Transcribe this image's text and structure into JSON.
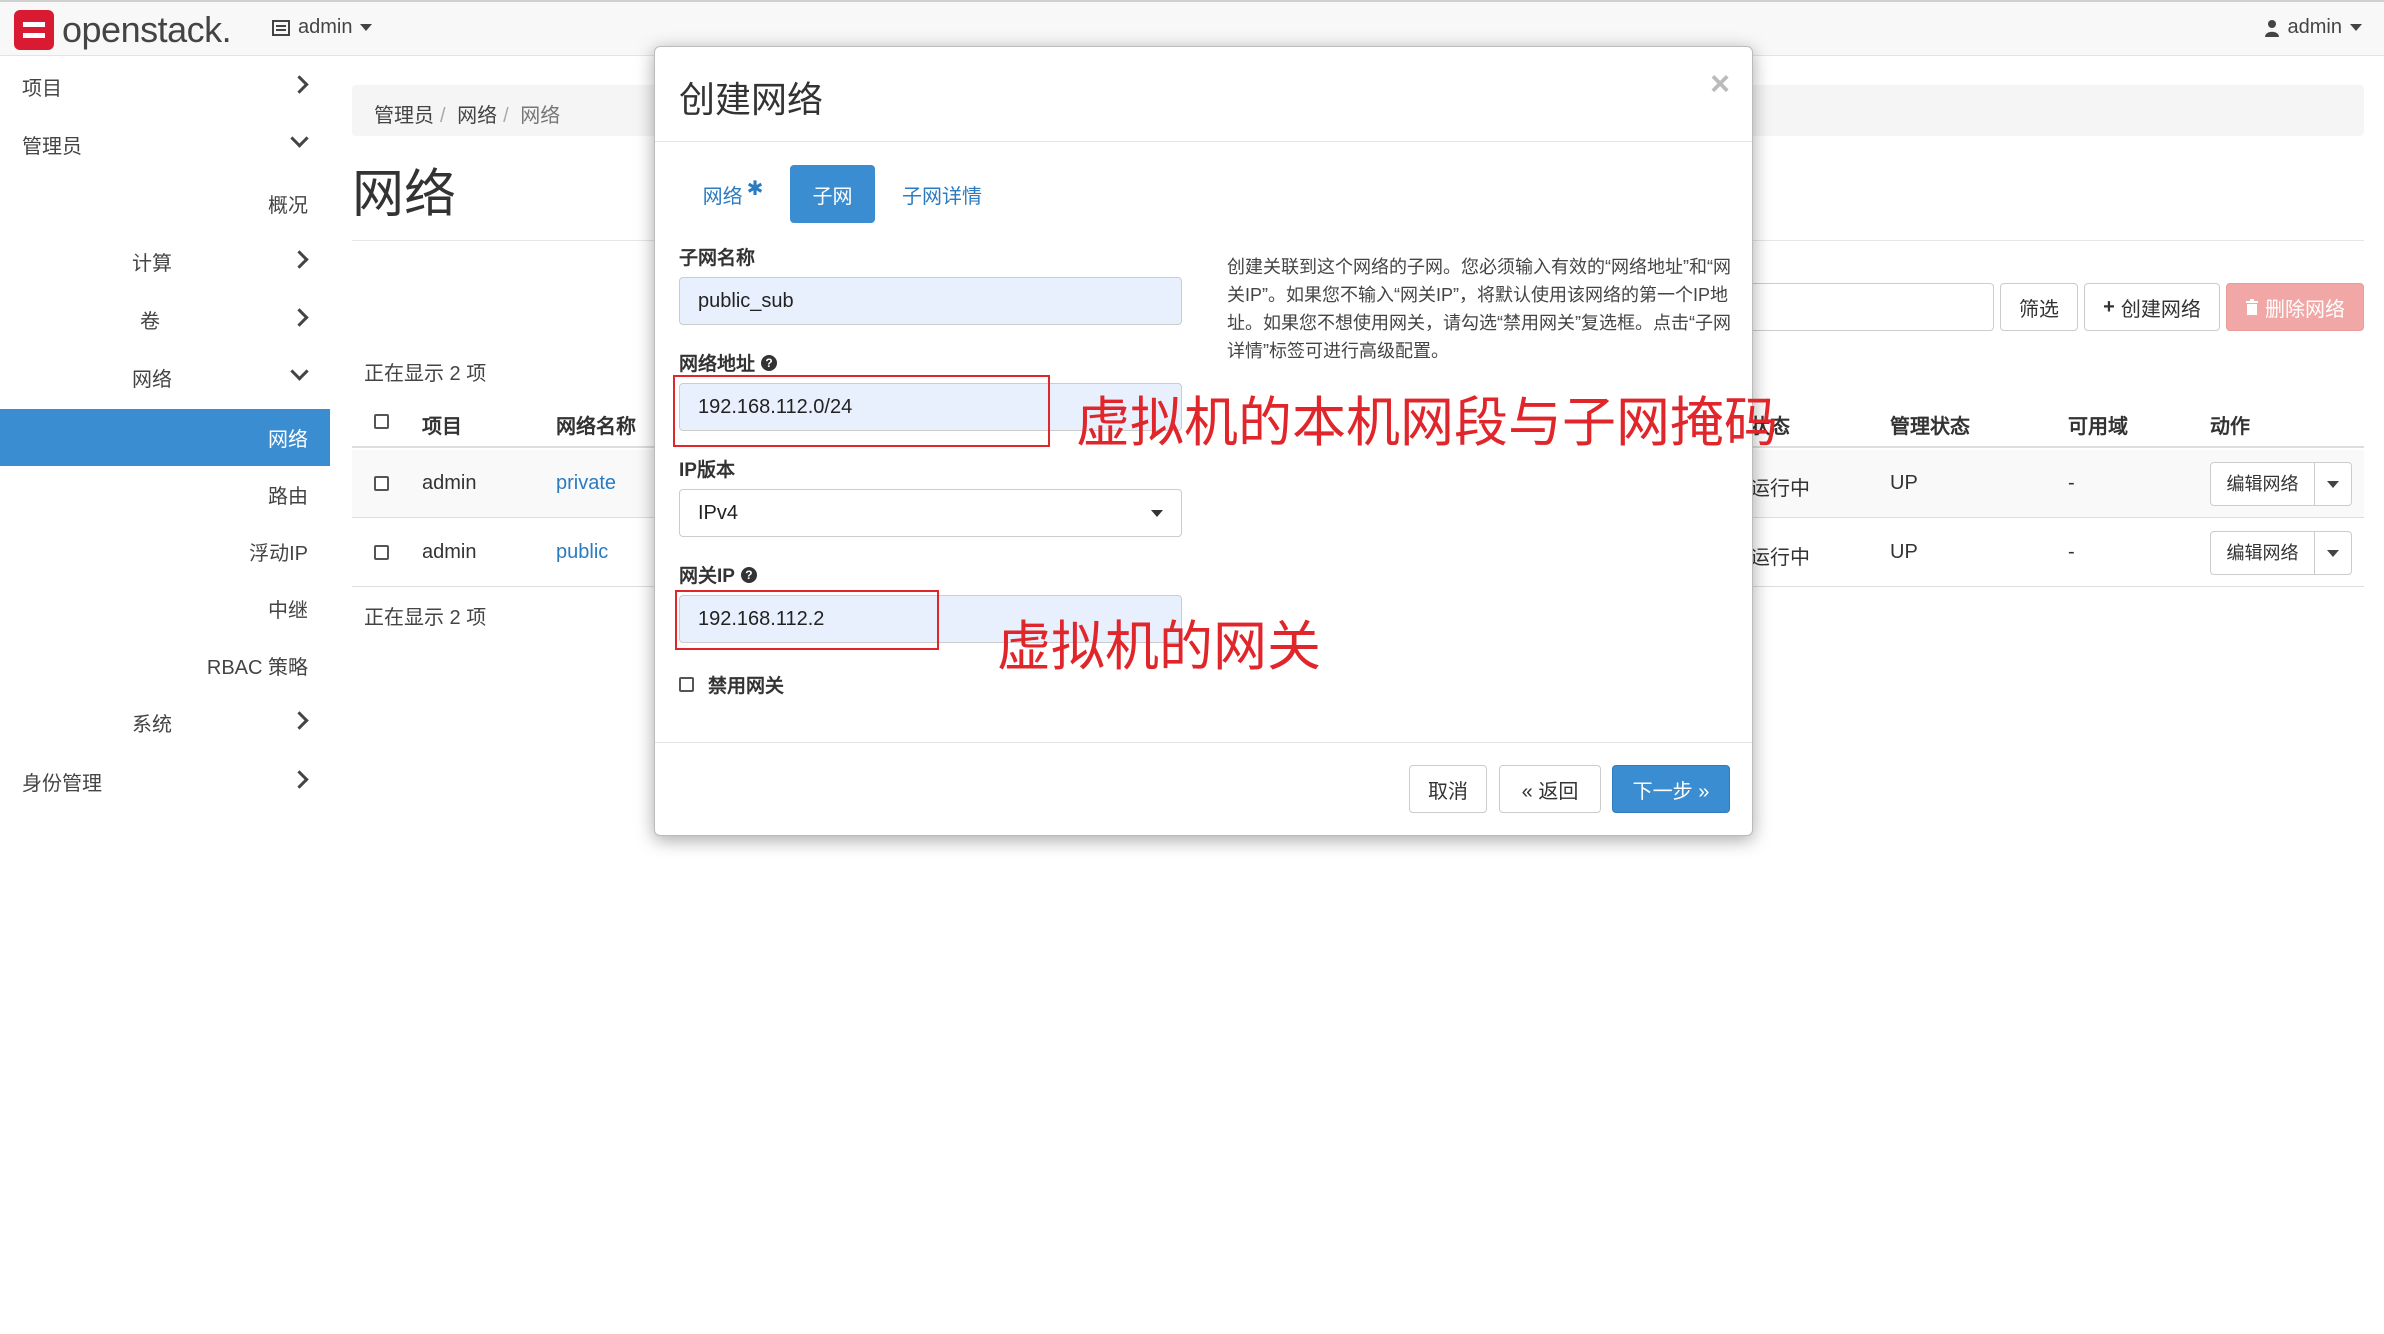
{
  "navbar": {
    "logo_text": "openstack.",
    "project": "admin",
    "user": "admin"
  },
  "sidebar": {
    "items": [
      {
        "label": "项目"
      },
      {
        "label": "管理员"
      },
      {
        "label": "概况"
      },
      {
        "label": "计算"
      },
      {
        "label": "卷"
      },
      {
        "label": "网络"
      },
      {
        "label": "网络"
      },
      {
        "label": "路由"
      },
      {
        "label": "浮动IP"
      },
      {
        "label": "中继"
      },
      {
        "label": "RBAC 策略"
      },
      {
        "label": "系统"
      },
      {
        "label": "身份管理"
      }
    ]
  },
  "breadcrumb": {
    "items": [
      "管理员",
      "网络",
      "网络"
    ]
  },
  "page": {
    "title": "网络",
    "filter_button": "筛选",
    "create_button": "创建网络",
    "delete_button": "删除网络",
    "count_text": "正在显示 2 项"
  },
  "table": {
    "headers": [
      "项目",
      "网络名称",
      "状态",
      "管理状态",
      "可用域",
      "动作"
    ],
    "rows": [
      {
        "project": "admin",
        "name": "private",
        "status": "运行中",
        "admin_state": "UP",
        "az": "-",
        "action": "编辑网络"
      },
      {
        "project": "admin",
        "name": "public",
        "status": "运行中",
        "admin_state": "UP",
        "az": "-",
        "action": "编辑网络"
      }
    ]
  },
  "modal": {
    "title": "创建网络",
    "close": "×",
    "tabs": [
      {
        "label": "网络",
        "required": "✱"
      },
      {
        "label": "子网"
      },
      {
        "label": "子网详情"
      }
    ],
    "fields": {
      "subnet_name_label": "子网名称",
      "subnet_name_value": "public_sub",
      "network_address_label": "网络地址",
      "network_address_value": "192.168.112.0/24",
      "ip_version_label": "IP版本",
      "ip_version_value": "IPv4",
      "gateway_label": "网关IP",
      "gateway_value": "192.168.112.2",
      "disable_gateway_label": "禁用网关"
    },
    "help_text": "创建关联到这个网络的子网。您必须输入有效的“网络地址”和“网关IP”。如果您不输入“网关IP”，将默认使用该网络的第一个IP地址。如果您不想使用网关，请勾选“禁用网关”复选框。点击“子网详情”标签可进行高级配置。",
    "buttons": {
      "cancel": "取消",
      "back": "« 返回",
      "next": "下一步 »"
    }
  },
  "annotations": {
    "network_note": "虚拟机的本机网段与子网掩码",
    "gateway_note": "虚拟机的网关",
    "color": "#e0262b"
  }
}
